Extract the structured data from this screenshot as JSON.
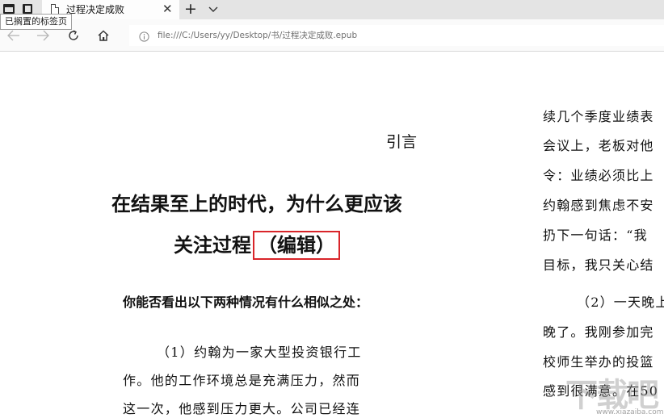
{
  "tabbar": {
    "active_tab_title": "过程决定成败",
    "close_glyph": "✕",
    "new_tab_glyph": "+"
  },
  "tooltip": "已搁置的标签页",
  "address": {
    "url": "file:///C:/Users/yy/Desktop/书/过程决定成败.epub"
  },
  "content": {
    "chapter_label": "引言",
    "headline_line1": "在结果至上的时代，为什么更应该",
    "headline_line2": "关注过程",
    "headline_highlight": "（编辑）",
    "question": "你能否看出以下两种情况有什么相似之处：",
    "paragraph_lines": [
      "（1）约翰为一家大型投资银行工",
      "作。他的工作环境总是充满压力，然而",
      "这一次，他感到压力更大。公司已经连"
    ],
    "right_column_lines": [
      "续几个季度业绩表",
      "会议上，老板对他",
      "令：业绩必须比上",
      "约翰感到焦虑不安",
      "扔下一句话：“我",
      "目标，我只关心结",
      "（2）一天晚上",
      "晚了。我刚参加完",
      "校师生举办的投篮",
      "感到很满意。在50"
    ]
  },
  "watermark": {
    "text": "下载吧",
    "url": "www.xiazaiba.com"
  },
  "colors": {
    "highlight_border": "#d9252a",
    "tabbar_bg": "#e4e4e4"
  }
}
